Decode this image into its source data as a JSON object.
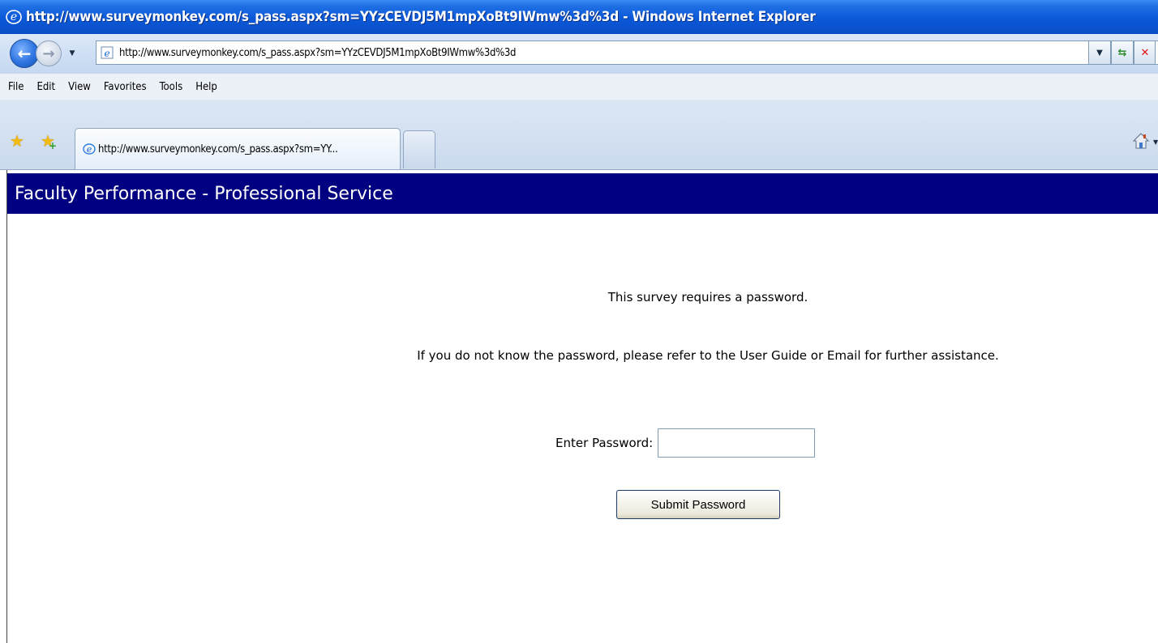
{
  "window": {
    "title": "http://www.surveymonkey.com/s_pass.aspx?sm=YYzCEVDJ5M1mpXoBt9IWmw%3d%3d - Windows Internet Explorer"
  },
  "address_bar": {
    "url": "http://www.surveymonkey.com/s_pass.aspx?sm=YYzCEVDJ5M1mpXoBt9IWmw%3d%3d"
  },
  "menu": {
    "items": [
      "File",
      "Edit",
      "View",
      "Favorites",
      "Tools",
      "Help"
    ]
  },
  "tabs": {
    "active_label": "http://www.surveymonkey.com/s_pass.aspx?sm=YY..."
  },
  "page": {
    "header_title": "Faculty Performance - Professional Service",
    "password_required_text": "This survey requires a password.",
    "help_text": "If you do not know the password, please refer to the User Guide or Email for further assistance.",
    "password_label": "Enter Password:",
    "password_value": "",
    "submit_label": "Submit Password"
  },
  "colors": {
    "header_banner": "#000080",
    "title_bar": "#0b58d8"
  },
  "icons": [
    "ie-logo-icon",
    "back-arrow-icon",
    "forward-arrow-icon",
    "page-icon",
    "dropdown-arrow-icon",
    "refresh-icon",
    "stop-icon",
    "favorites-star-icon",
    "add-favorites-icon",
    "home-icon"
  ]
}
